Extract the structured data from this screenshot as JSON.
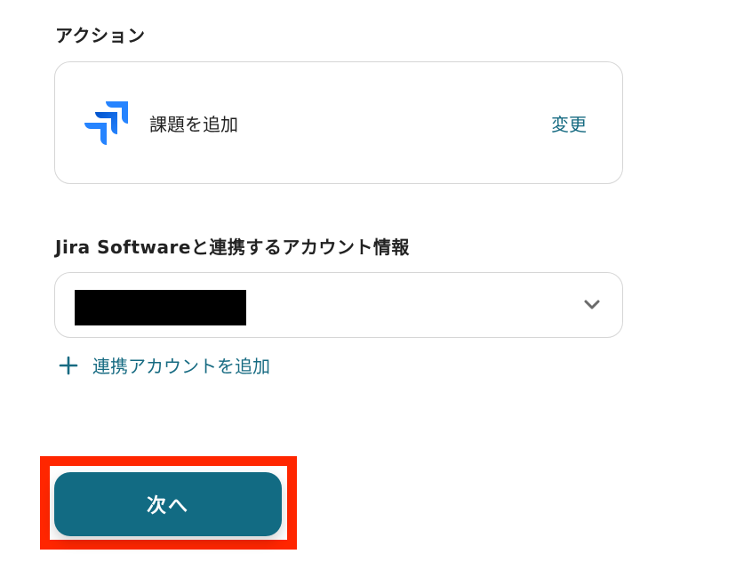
{
  "action_section": {
    "label": "アクション",
    "card": {
      "icon": "jira-logo-icon",
      "action_name": "課題を追加",
      "change_label": "変更"
    }
  },
  "account_section": {
    "label": "Jira Softwareと連携するアカウント情報",
    "select": {
      "value_redacted": true,
      "icon": "chevron-down-icon"
    },
    "add_account_label": "連携アカウントを追加"
  },
  "footer": {
    "next_label": "次へ"
  },
  "colors": {
    "accent": "#176b82",
    "button_bg": "#126b83",
    "highlight": "#ff2600",
    "jira_blue_light": "#2684ff",
    "jira_blue_dark": "#0052cc"
  }
}
